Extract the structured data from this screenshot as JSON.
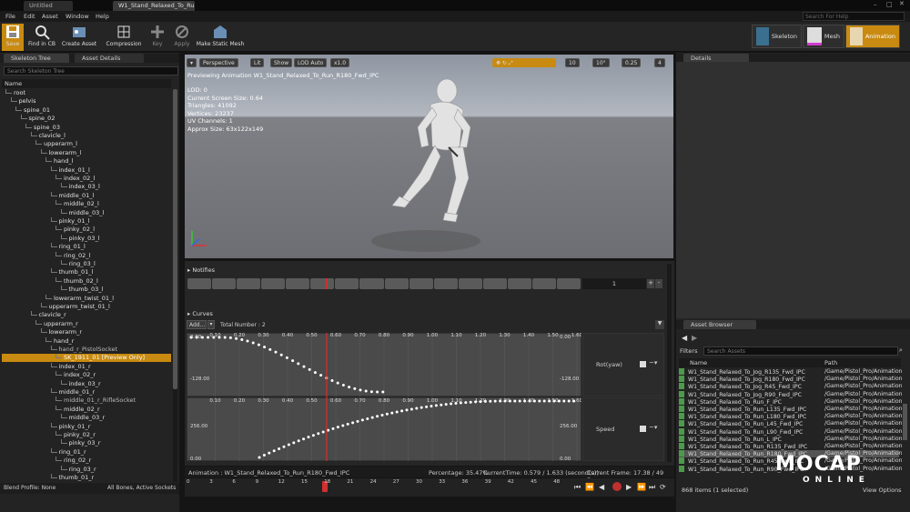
{
  "window": {
    "tabs": [
      "Untitled",
      "W1_Stand_Relaxed_To_Ru"
    ]
  },
  "menu": [
    "File",
    "Edit",
    "Asset",
    "Window",
    "Help"
  ],
  "help_search": {
    "placeholder": "Search For Help"
  },
  "toolbar": {
    "buttons": [
      {
        "label": "Save",
        "icon": "save-icon"
      },
      {
        "label": "Find in CB",
        "icon": "magnifier-icon"
      },
      {
        "label": "Create Asset",
        "icon": "create-asset-icon"
      },
      {
        "label": "Compression",
        "icon": "compression-icon"
      },
      {
        "label": "Key",
        "icon": "plus-icon"
      },
      {
        "label": "Apply",
        "icon": "apply-icon"
      },
      {
        "label": "Make Static Mesh",
        "icon": "static-mesh-icon"
      }
    ],
    "modes": [
      {
        "label": "Skeleton",
        "active": false
      },
      {
        "label": "Mesh",
        "active": false
      },
      {
        "label": "Animation",
        "active": true
      }
    ]
  },
  "left": {
    "tabs": [
      "Skeleton Tree",
      "Asset Details"
    ],
    "search_placeholder": "Search Skeleton Tree",
    "column": "Name",
    "tree": [
      {
        "name": "root",
        "d": 0
      },
      {
        "name": "pelvis",
        "d": 1
      },
      {
        "name": "spine_01",
        "d": 2
      },
      {
        "name": "spine_02",
        "d": 3
      },
      {
        "name": "spine_03",
        "d": 4
      },
      {
        "name": "clavicle_l",
        "d": 5
      },
      {
        "name": "upperarm_l",
        "d": 6
      },
      {
        "name": "lowerarm_l",
        "d": 7
      },
      {
        "name": "hand_l",
        "d": 8
      },
      {
        "name": "index_01_l",
        "d": 9
      },
      {
        "name": "index_02_l",
        "d": 10
      },
      {
        "name": "index_03_l",
        "d": 11
      },
      {
        "name": "middle_01_l",
        "d": 9
      },
      {
        "name": "middle_02_l",
        "d": 10
      },
      {
        "name": "middle_03_l",
        "d": 11
      },
      {
        "name": "pinky_01_l",
        "d": 9
      },
      {
        "name": "pinky_02_l",
        "d": 10
      },
      {
        "name": "pinky_03_l",
        "d": 11
      },
      {
        "name": "ring_01_l",
        "d": 9
      },
      {
        "name": "ring_02_l",
        "d": 10
      },
      {
        "name": "ring_03_l",
        "d": 11
      },
      {
        "name": "thumb_01_l",
        "d": 9
      },
      {
        "name": "thumb_02_l",
        "d": 10
      },
      {
        "name": "thumb_03_l",
        "d": 11
      },
      {
        "name": "lowerarm_twist_01_l",
        "d": 8
      },
      {
        "name": "upperarm_twist_01_l",
        "d": 7
      },
      {
        "name": "clavicle_r",
        "d": 5
      },
      {
        "name": "upperarm_r",
        "d": 6
      },
      {
        "name": "lowerarm_r",
        "d": 7
      },
      {
        "name": "hand_r",
        "d": 8
      },
      {
        "name": "hand_r_PistolSocket",
        "d": 9,
        "socket": true
      },
      {
        "name": "SK_1911_01 [Preview Only]",
        "d": 10,
        "selected": true
      },
      {
        "name": "index_01_r",
        "d": 9
      },
      {
        "name": "index_02_r",
        "d": 10
      },
      {
        "name": "index_03_r",
        "d": 11
      },
      {
        "name": "middle_01_r",
        "d": 9
      },
      {
        "name": "middle_01_r_RifleSocket",
        "d": 10,
        "socket": true
      },
      {
        "name": "middle_02_r",
        "d": 10
      },
      {
        "name": "middle_03_r",
        "d": 11
      },
      {
        "name": "pinky_01_r",
        "d": 9
      },
      {
        "name": "pinky_02_r",
        "d": 10
      },
      {
        "name": "pinky_03_r",
        "d": 11
      },
      {
        "name": "ring_01_r",
        "d": 9
      },
      {
        "name": "ring_02_r",
        "d": 10
      },
      {
        "name": "ring_03_r",
        "d": 11
      },
      {
        "name": "thumb_01_r",
        "d": 9
      }
    ],
    "footer_left": "Blend Profile: None",
    "footer_right": "All Bones, Active Sockets"
  },
  "viewport": {
    "buttons": [
      "Perspective",
      "Lit",
      "Show",
      "LOD Auto",
      "x1.0"
    ],
    "right_values": [
      "10",
      "10°",
      "0.25",
      "4"
    ],
    "previewing": "Previewing Animation W1_Stand_Relaxed_To_Run_R180_Fwd_IPC",
    "stats": [
      "LOD: 0",
      "Current Screen Size: 0.64",
      "Triangles: 41092",
      "Vertices: 23237",
      "UV Channels: 1",
      "Approx Size: 63x122x149"
    ]
  },
  "notifies": {
    "title": "Notifies",
    "track_value": "1"
  },
  "curves": {
    "title": "Curves",
    "add_label": "Add...",
    "total": "Total Number : 2",
    "ticks": [
      "0.10",
      "0.20",
      "0.30",
      "0.40",
      "0.50",
      "0.60",
      "0.70",
      "0.80",
      "0.90",
      "1.00",
      "1.10",
      "1.20",
      "1.30",
      "1.40",
      "1.50",
      "1.60"
    ],
    "rot": {
      "name": "Rot(yaw)",
      "top": "0.00",
      "bottom": "-128.00"
    },
    "speed": {
      "name": "Speed",
      "top": "256.00",
      "bottom": "0.00"
    }
  },
  "status": {
    "animation": "Animation : W1_Stand_Relaxed_To_Run_R180_Fwd_IPC",
    "percentage": "Percentage: 35.47%",
    "current_time": "CurrentTime: 0.579 / 1.633 (second(s))",
    "current_frame": "Current Frame: 17.38 / 49 Frame"
  },
  "timeline": {
    "ticks": [
      "0",
      "3",
      "6",
      "9",
      "12",
      "15",
      "18",
      "21",
      "24",
      "27",
      "30",
      "33",
      "36",
      "39",
      "42",
      "45",
      "48"
    ],
    "position_fraction": 0.3547
  },
  "right": {
    "details_tab": "Details",
    "asset_browser_tab": "Asset Browser",
    "filters": "Filters",
    "search_placeholder": "Search Assets",
    "col_name": "Name",
    "col_path": "Path",
    "assets": [
      {
        "name": "W1_Stand_Relaxed_To_Jog_R135_Fwd_IPC",
        "path": "/Game/Pistol_Pro/Animation"
      },
      {
        "name": "W1_Stand_Relaxed_To_Jog_R180_Fwd_IPC",
        "path": "/Game/Pistol_Pro/Animation"
      },
      {
        "name": "W1_Stand_Relaxed_To_Jog_R45_Fwd_IPC",
        "path": "/Game/Pistol_Pro/Animation"
      },
      {
        "name": "W1_Stand_Relaxed_To_Jog_R90_Fwd_IPC",
        "path": "/Game/Pistol_Pro/Animation"
      },
      {
        "name": "W1_Stand_Relaxed_To_Run_F_IPC",
        "path": "/Game/Pistol_Pro/Animation"
      },
      {
        "name": "W1_Stand_Relaxed_To_Run_L135_Fwd_IPC",
        "path": "/Game/Pistol_Pro/Animation"
      },
      {
        "name": "W1_Stand_Relaxed_To_Run_L180_Fwd_IPC",
        "path": "/Game/Pistol_Pro/Animation"
      },
      {
        "name": "W1_Stand_Relaxed_To_Run_L45_Fwd_IPC",
        "path": "/Game/Pistol_Pro/Animation"
      },
      {
        "name": "W1_Stand_Relaxed_To_Run_L90_Fwd_IPC",
        "path": "/Game/Pistol_Pro/Animation"
      },
      {
        "name": "W1_Stand_Relaxed_To_Run_L_IPC",
        "path": "/Game/Pistol_Pro/Animation"
      },
      {
        "name": "W1_Stand_Relaxed_To_Run_R135_Fwd_IPC",
        "path": "/Game/Pistol_Pro/Animation"
      },
      {
        "name": "W1_Stand_Relaxed_To_Run_R180_Fwd_IPC",
        "path": "/Game/Pistol_Pro/Animation",
        "selected": true
      },
      {
        "name": "W1_Stand_Relaxed_To_Run_R45_Fwd_IPC",
        "path": "/Game/Pistol_Pro/Animation"
      },
      {
        "name": "W1_Stand_Relaxed_To_Run_R90_Fwd_IPC",
        "path": "/Game/Pistol_Pro/Animation"
      }
    ],
    "count": "868 items (1 selected)",
    "view_options": "View Options"
  },
  "logo": {
    "line1": "MOCAP",
    "line2": "ONLINE"
  },
  "colors": {
    "accent": "#c88a10",
    "track": "#4a4a4a",
    "marker": "#d03030"
  }
}
